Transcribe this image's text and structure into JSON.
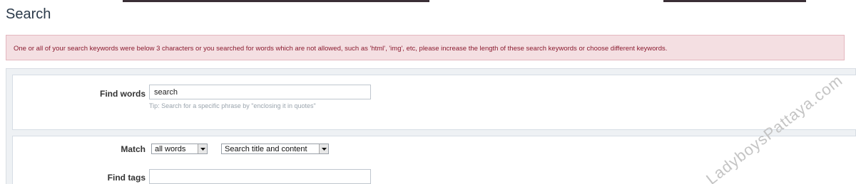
{
  "page": {
    "title": "Search"
  },
  "error": {
    "message": "One or all of your search keywords were below 3 characters or you searched for words which are not allowed, such as 'html', 'img', etc, please increase the length of these search keywords or choose different keywords."
  },
  "find_words": {
    "label": "Find words",
    "value": "search",
    "tip": "Tip: Search for a specific phrase by \"enclosing it in quotes\""
  },
  "match": {
    "label": "Match",
    "mode_value": "all words",
    "scope_value": "Search title and content"
  },
  "find_tags": {
    "label": "Find tags",
    "value": ""
  },
  "watermark": {
    "text": "LadyboysPattaya.com"
  },
  "colors": {
    "title": "#2b3a4a",
    "error_bg": "#f4dfe2",
    "error_text": "#8a1b2f",
    "label": "#333333"
  }
}
